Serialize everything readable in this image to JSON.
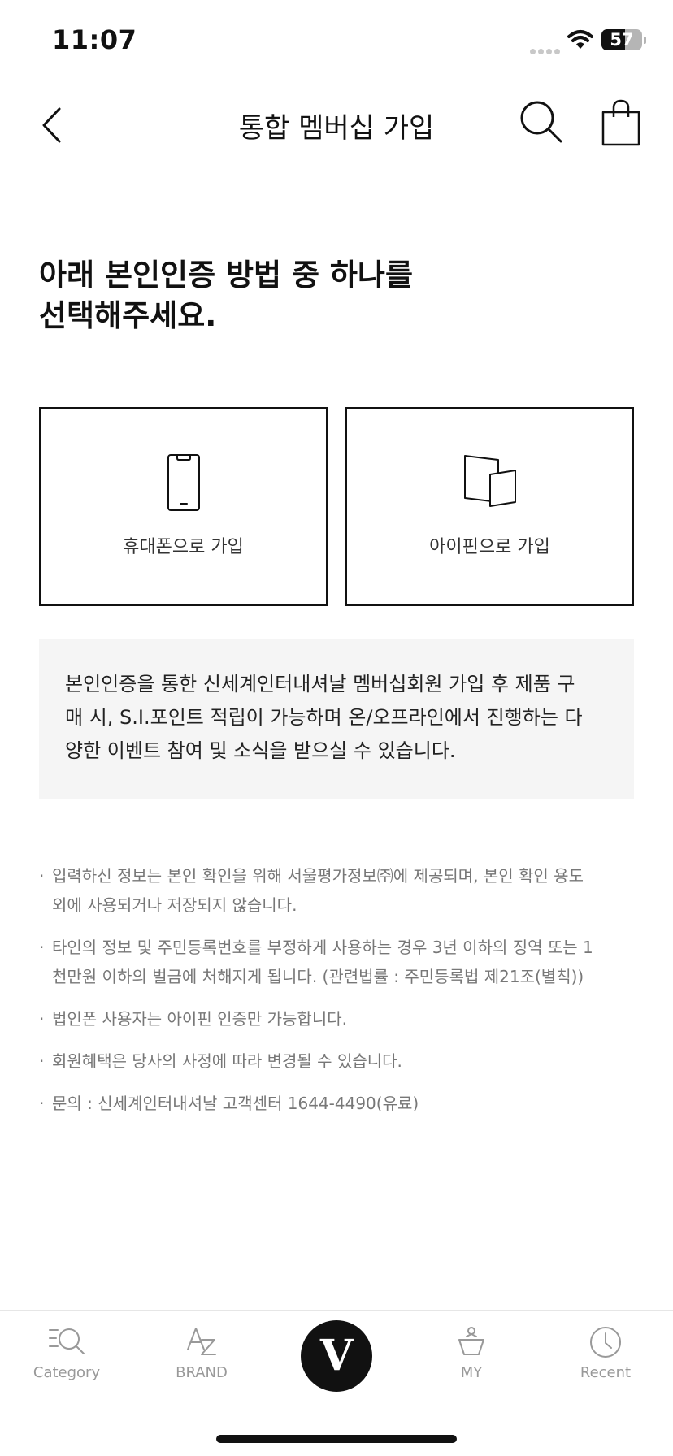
{
  "status_bar": {
    "time": "11:07",
    "battery_level": "57",
    "icons": [
      "signal-icon",
      "wifi-icon",
      "battery-icon"
    ]
  },
  "header": {
    "title": "통합 멤버십 가입",
    "icons": [
      "chevron-left-icon",
      "search-icon",
      "shopping-bag-icon"
    ]
  },
  "heading": {
    "line1": "아래 본인인증 방법 중 하나를",
    "line2": "선택해주세요."
  },
  "options": [
    {
      "label": "휴대폰으로 가입",
      "icon": "smartphone-icon"
    },
    {
      "label": "아이핀으로 가입",
      "icon": "ipin-card-icon"
    }
  ],
  "info": {
    "lines": [
      "본인인증을 통한 신세계인터내셔날 멤버십회원 가입 후 제품 구",
      "매 시, S.I.포인트 적립이 가능하며 온/오프라인에서 진행하는 다",
      "양한 이벤트 참여 및 소식을 받으실 수 있습니다."
    ]
  },
  "notices": [
    {
      "lines": [
        "입력하신 정보는 본인 확인을 위해 서울평가정보㈜에 제공되며, 본인 확인 용도",
        "외에 사용되거나 저장되지 않습니다."
      ]
    },
    {
      "lines": [
        "타인의 정보 및 주민등록번호를 부정하게 사용하는 경우 3년 이하의 징역 또는 1",
        "천만원 이하의 벌금에 처해지게 됩니다. (관련법률 : 주민등록법 제21조(별칙))"
      ]
    },
    {
      "lines": [
        "법인폰 사용자는 아이핀 인증만 가능합니다."
      ]
    },
    {
      "lines": [
        "회원혜택은 당사의 사정에 따라 변경될 수 있습니다."
      ]
    },
    {
      "lines": [
        "문의 : 신세계인터내셔날 고객센터 1644-4490(유료)"
      ]
    }
  ],
  "tab_bar": {
    "items": [
      {
        "label": "Category",
        "icon": "category-search-icon"
      },
      {
        "label": "BRAND",
        "icon": "brand-az-icon"
      },
      {
        "label": "V",
        "icon": "v-logo-icon"
      },
      {
        "label": "MY",
        "icon": "my-shopping-icon"
      },
      {
        "label": "Recent",
        "icon": "clock-icon"
      }
    ]
  }
}
